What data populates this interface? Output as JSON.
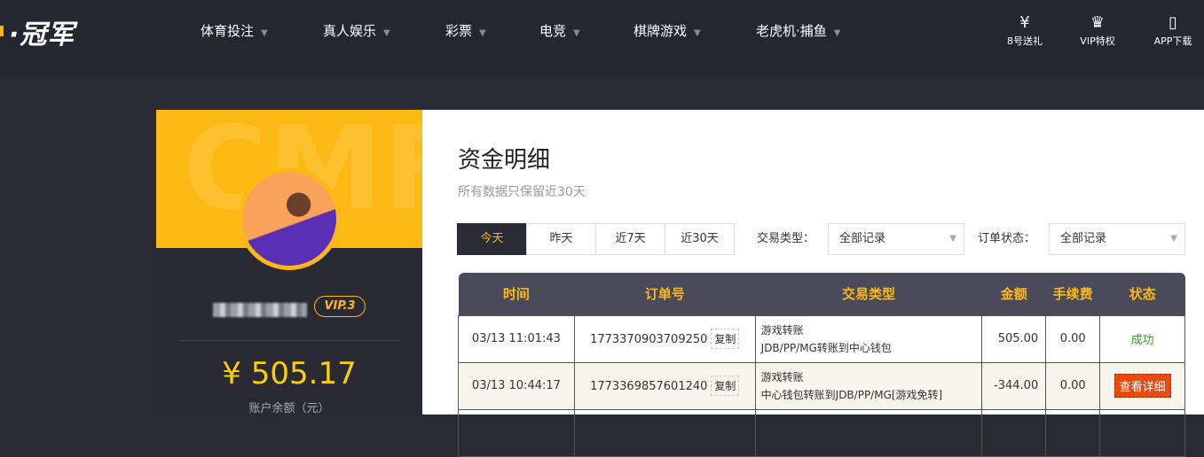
{
  "header": {
    "logo": "·冠军",
    "nav": [
      {
        "label": "体育投注"
      },
      {
        "label": "真人娱乐"
      },
      {
        "label": "彩票"
      },
      {
        "label": "电竞"
      },
      {
        "label": "棋牌游戏"
      },
      {
        "label": "老虎机·捕鱼"
      }
    ],
    "quick": [
      {
        "label": "8号送礼",
        "icon": "ticket-yen-icon"
      },
      {
        "label": "VIP特权",
        "icon": "crown-icon"
      },
      {
        "label": "APP下载",
        "icon": "phone-icon"
      }
    ]
  },
  "profile": {
    "watermark": "CMF",
    "vip": "VIP.3",
    "balance": "¥ 505.17",
    "balance_label": "账户余额（元）"
  },
  "main": {
    "title": "资金明细",
    "subtitle": "所有数据只保留近30天",
    "tabs": [
      {
        "label": "今天",
        "active": true
      },
      {
        "label": "昨天"
      },
      {
        "label": "近7天"
      },
      {
        "label": "近30天"
      }
    ],
    "type_label": "交易类型：",
    "type_value": "全部记录",
    "status_label": "订单状态：",
    "status_value": "全部记录",
    "columns": [
      "时间",
      "订单号",
      "交易类型",
      "金额",
      "手续费",
      "状态"
    ],
    "rows": [
      {
        "time": "03/13 11:01:43",
        "order": "1773370903709250",
        "copy": "复制",
        "type": "游戏转账",
        "desc": "JDB/PP/MG转账到中心钱包",
        "amount": "505.00",
        "fee": "0.00",
        "status": "成功"
      },
      {
        "time": "03/13 10:44:17",
        "order": "1773369857601240",
        "copy": "复制",
        "type": "游戏转账",
        "desc": "中心钱包转账到JDB/PP/MG[游戏免转]",
        "amount": "-344.00",
        "fee": "0.00",
        "status": "查看详细"
      }
    ]
  }
}
